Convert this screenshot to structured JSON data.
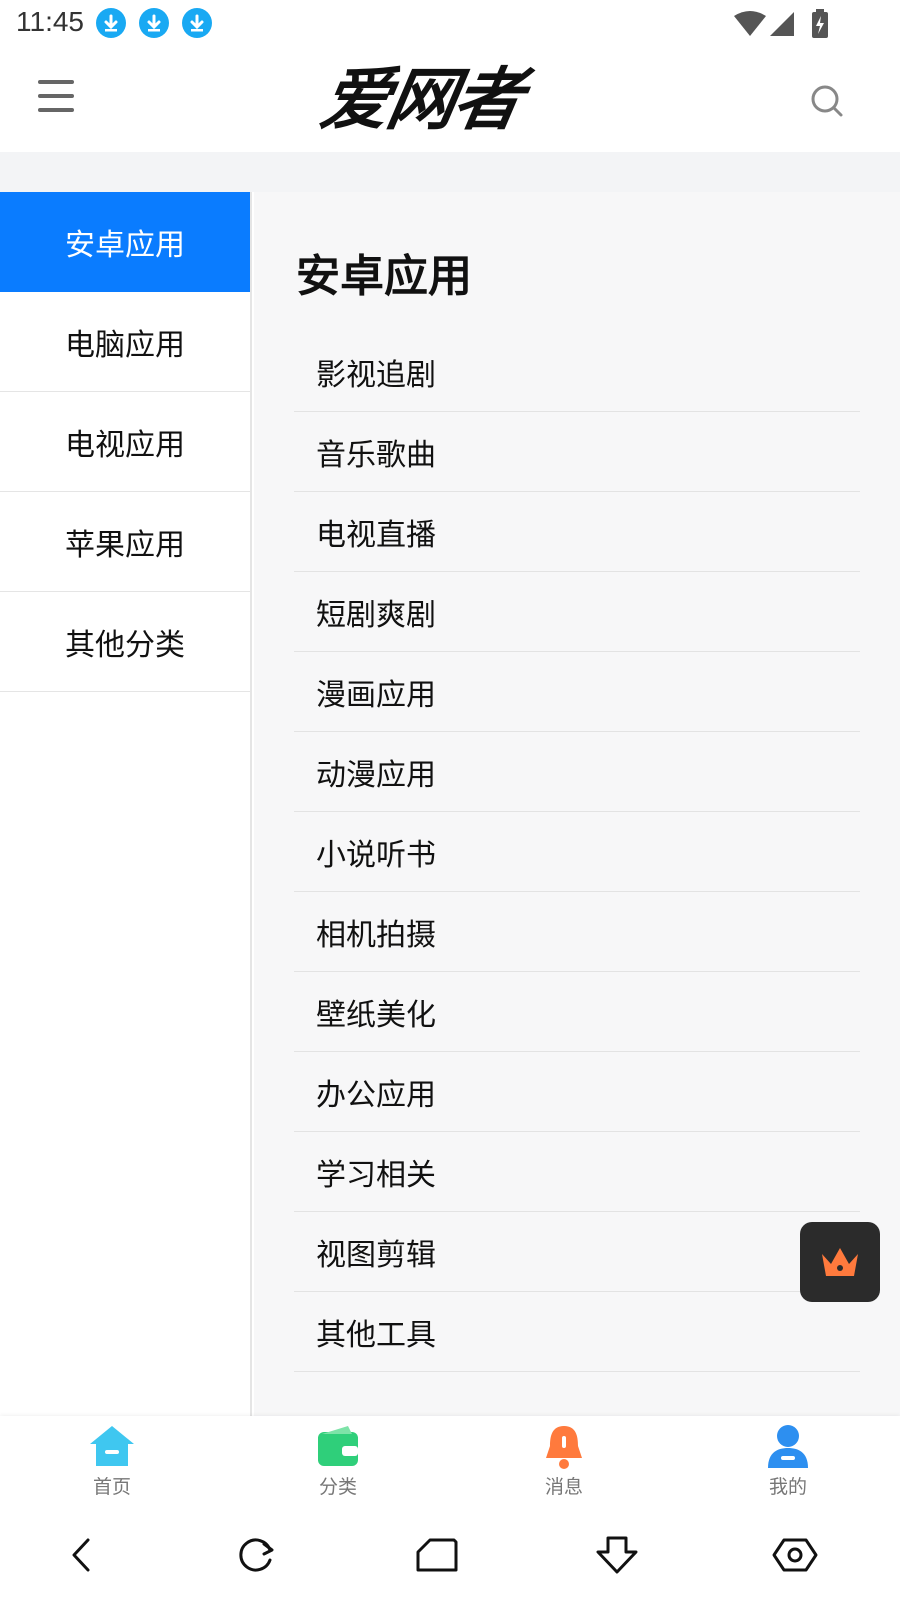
{
  "status_bar": {
    "time": "11:45",
    "download_icons": [
      "download-icon",
      "download-icon",
      "download-icon"
    ],
    "right_icons": [
      "wifi-icon",
      "signal-icon",
      "battery-charging-icon"
    ]
  },
  "header": {
    "logo_text": "爱网者",
    "menu_icon": "menu-icon",
    "search_icon": "search-icon"
  },
  "left_nav": {
    "items": [
      {
        "label": "安卓应用",
        "active": true
      },
      {
        "label": "电脑应用",
        "active": false
      },
      {
        "label": "电视应用",
        "active": false
      },
      {
        "label": "苹果应用",
        "active": false
      },
      {
        "label": "其他分类",
        "active": false
      }
    ]
  },
  "content": {
    "title": "安卓应用",
    "items": [
      "影视追剧",
      "音乐歌曲",
      "电视直播",
      "短剧爽剧",
      "漫画应用",
      "动漫应用",
      "小说听书",
      "相机拍摄",
      "壁纸美化",
      "办公应用",
      "学习相关",
      "视图剪辑",
      "其他工具"
    ]
  },
  "float_button": {
    "icon": "crown-icon"
  },
  "tab_bar": {
    "tabs": [
      {
        "label": "首页",
        "icon": "home-icon"
      },
      {
        "label": "分类",
        "icon": "wallet-icon"
      },
      {
        "label": "消息",
        "icon": "bell-icon"
      },
      {
        "label": "我的",
        "icon": "user-icon"
      }
    ]
  },
  "system_nav": {
    "buttons": [
      "back-icon",
      "refresh-icon",
      "home-shape-icon",
      "download-arrow-icon",
      "eye-icon"
    ]
  },
  "colors": {
    "accent": "#0a7cff",
    "download_badge": "#19a9f3",
    "tab_home": "#3fc7f0",
    "tab_category": "#2fcf7a",
    "tab_message": "#ff7a3d",
    "tab_mine": "#2d8ff0"
  }
}
